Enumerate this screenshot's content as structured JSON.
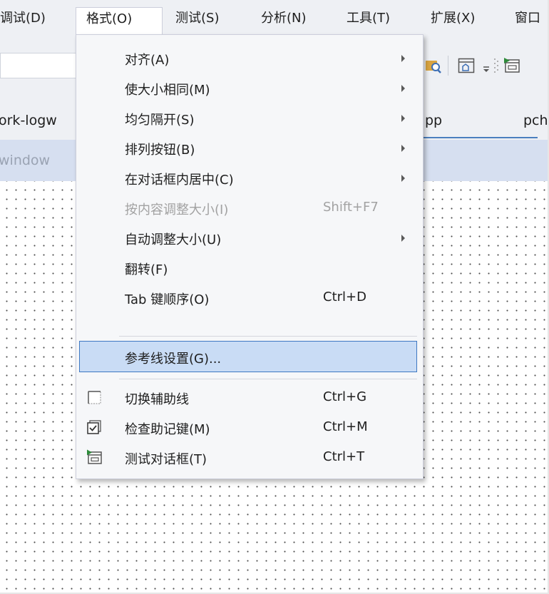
{
  "menubar": {
    "items": [
      {
        "label": "调试(D)"
      },
      {
        "label": "格式(O)"
      },
      {
        "label": "测试(S)"
      },
      {
        "label": "分析(N)"
      },
      {
        "label": "工具(T)"
      },
      {
        "label": "扩展(X)"
      },
      {
        "label": "窗口"
      }
    ]
  },
  "tabs": {
    "items": [
      {
        "label": "ork-logw"
      },
      {
        "label": "pp"
      },
      {
        "label": "pch"
      }
    ]
  },
  "designer": {
    "title": "window"
  },
  "format_menu": {
    "items": [
      {
        "label": "对齐(A)",
        "submenu": true
      },
      {
        "label": "使大小相同(M)",
        "submenu": true
      },
      {
        "label": "均匀隔开(S)",
        "submenu": true
      },
      {
        "label": "排列按钮(B)",
        "submenu": true
      },
      {
        "label": "在对话框内居中(C)",
        "submenu": true
      },
      {
        "label": "按内容调整大小(I)",
        "shortcut": "Shift+F7",
        "disabled": true
      },
      {
        "label": "自动调整大小(U)",
        "submenu": true
      },
      {
        "label": "翻转(F)"
      },
      {
        "label": "Tab 键顺序(O)",
        "shortcut": "Ctrl+D"
      },
      {
        "label": "参考线设置(G)...",
        "highlighted": true
      },
      {
        "label": "切换辅助线",
        "shortcut": "Ctrl+G",
        "icon": "toggle-guides-icon"
      },
      {
        "label": "检查助记键(M)",
        "shortcut": "Ctrl+M",
        "icon": "check-mnemonics-icon"
      },
      {
        "label": "测试对话框(T)",
        "shortcut": "Ctrl+T",
        "icon": "test-dialog-icon"
      }
    ]
  },
  "colors": {
    "highlight_bg": "#c9dcf5",
    "highlight_border": "#3e78c2",
    "disabled_text": "#a2a2a2",
    "chrome_bg": "#eef0f4"
  }
}
